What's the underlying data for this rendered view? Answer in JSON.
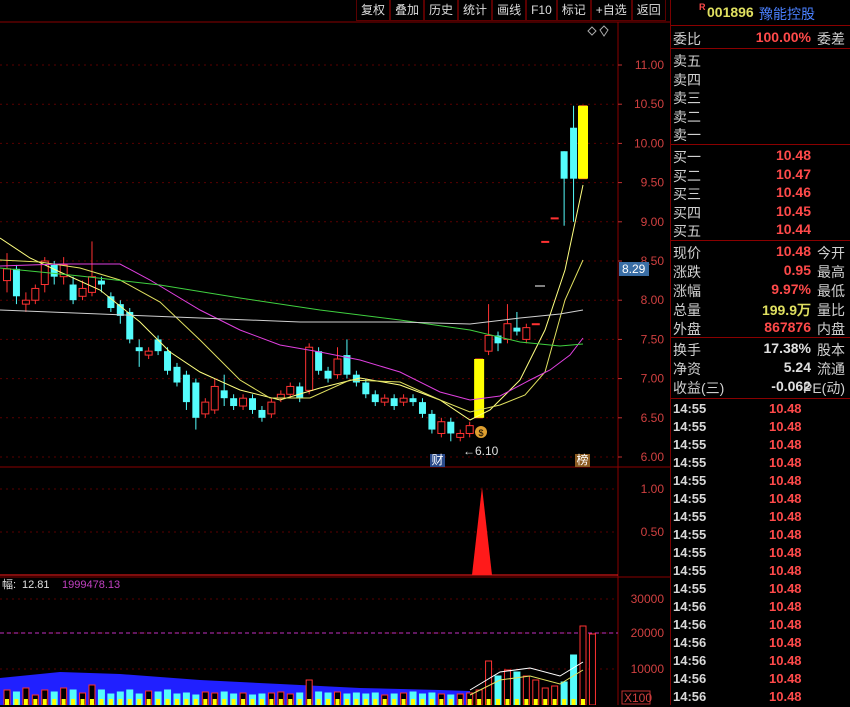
{
  "toolbar": [
    "复权",
    "叠加",
    "历史",
    "统计",
    "画线",
    "F10",
    "标记",
    "+自选",
    "返回"
  ],
  "price_axis": [
    "11.00",
    "10.50",
    "10.00",
    "9.50",
    "9.00",
    "8.50",
    "8.00",
    "7.50",
    "7.00",
    "6.50",
    "6.00"
  ],
  "indicator_axis": [
    "1.00",
    "0.50"
  ],
  "volume_axis": [
    "30000",
    "20000",
    "10000"
  ],
  "current_price_tag": "8.29",
  "low_label": "6.10",
  "markers": {
    "cai": "财",
    "bang": "榜"
  },
  "volume_legend": {
    "label": "幅:",
    "v1": "12.81",
    "v2": "1999478.13"
  },
  "volume_unit": "X100",
  "colors": {
    "up": "#ff3232",
    "down": "#54fcfc",
    "accent": "#ffff00"
  },
  "chart_data": {
    "type": "candlestick",
    "ylim": [
      6.0,
      11.0
    ],
    "candles": [
      {
        "o": 8.25,
        "c": 8.4,
        "h": 8.6,
        "l": 8.1
      },
      {
        "o": 8.4,
        "c": 8.05,
        "h": 8.45,
        "l": 7.95
      },
      {
        "o": 7.95,
        "c": 8.0,
        "h": 8.1,
        "l": 7.85
      },
      {
        "o": 8.0,
        "c": 8.15,
        "h": 8.2,
        "l": 7.95
      },
      {
        "o": 8.2,
        "c": 8.5,
        "h": 8.55,
        "l": 8.1
      },
      {
        "o": 8.45,
        "c": 8.3,
        "h": 8.5,
        "l": 8.2
      },
      {
        "o": 8.3,
        "c": 8.45,
        "h": 8.55,
        "l": 8.2
      },
      {
        "o": 8.2,
        "c": 8.0,
        "h": 8.3,
        "l": 7.95
      },
      {
        "o": 8.05,
        "c": 8.15,
        "h": 8.25,
        "l": 8.0
      },
      {
        "o": 8.1,
        "c": 8.3,
        "h": 8.75,
        "l": 8.05
      },
      {
        "o": 8.25,
        "c": 8.2,
        "h": 8.3,
        "l": 8.1
      },
      {
        "o": 8.05,
        "c": 7.9,
        "h": 8.1,
        "l": 7.85
      },
      {
        "o": 7.95,
        "c": 7.8,
        "h": 8.0,
        "l": 7.7
      },
      {
        "o": 7.85,
        "c": 7.5,
        "h": 7.9,
        "l": 7.45
      },
      {
        "o": 7.4,
        "c": 7.35,
        "h": 7.5,
        "l": 7.15
      },
      {
        "o": 7.3,
        "c": 7.35,
        "h": 7.4,
        "l": 7.25
      },
      {
        "o": 7.5,
        "c": 7.35,
        "h": 7.55,
        "l": 7.3
      },
      {
        "o": 7.35,
        "c": 7.1,
        "h": 7.4,
        "l": 7.05
      },
      {
        "o": 7.15,
        "c": 6.95,
        "h": 7.2,
        "l": 6.9
      },
      {
        "o": 7.05,
        "c": 6.7,
        "h": 7.1,
        "l": 6.6
      },
      {
        "o": 6.95,
        "c": 6.5,
        "h": 7.0,
        "l": 6.35
      },
      {
        "o": 6.55,
        "c": 6.7,
        "h": 6.75,
        "l": 6.5
      },
      {
        "o": 6.6,
        "c": 6.9,
        "h": 7.0,
        "l": 6.55
      },
      {
        "o": 6.85,
        "c": 6.75,
        "h": 7.05,
        "l": 6.65
      },
      {
        "o": 6.75,
        "c": 6.65,
        "h": 6.8,
        "l": 6.6
      },
      {
        "o": 6.65,
        "c": 6.75,
        "h": 6.8,
        "l": 6.6
      },
      {
        "o": 6.75,
        "c": 6.6,
        "h": 6.8,
        "l": 6.55
      },
      {
        "o": 6.6,
        "c": 6.5,
        "h": 6.65,
        "l": 6.45
      },
      {
        "o": 6.55,
        "c": 6.7,
        "h": 6.75,
        "l": 6.5
      },
      {
        "o": 6.75,
        "c": 6.8,
        "h": 6.85,
        "l": 6.7
      },
      {
        "o": 6.8,
        "c": 6.9,
        "h": 6.95,
        "l": 6.75
      },
      {
        "o": 6.9,
        "c": 6.75,
        "h": 6.95,
        "l": 6.7
      },
      {
        "o": 6.85,
        "c": 7.4,
        "h": 7.45,
        "l": 6.8
      },
      {
        "o": 7.35,
        "c": 7.1,
        "h": 7.4,
        "l": 7.05
      },
      {
        "o": 7.1,
        "c": 7.0,
        "h": 7.15,
        "l": 6.95
      },
      {
        "o": 7.05,
        "c": 7.25,
        "h": 7.4,
        "l": 7.0
      },
      {
        "o": 7.3,
        "c": 7.05,
        "h": 7.5,
        "l": 7.0
      },
      {
        "o": 7.05,
        "c": 6.95,
        "h": 7.1,
        "l": 6.9
      },
      {
        "o": 6.95,
        "c": 6.8,
        "h": 7.0,
        "l": 6.75
      },
      {
        "o": 6.8,
        "c": 6.7,
        "h": 6.85,
        "l": 6.65
      },
      {
        "o": 6.7,
        "c": 6.75,
        "h": 6.8,
        "l": 6.65
      },
      {
        "o": 6.75,
        "c": 6.65,
        "h": 6.8,
        "l": 6.6
      },
      {
        "o": 6.7,
        "c": 6.75,
        "h": 6.8,
        "l": 6.65
      },
      {
        "o": 6.75,
        "c": 6.7,
        "h": 6.8,
        "l": 6.65
      },
      {
        "o": 6.7,
        "c": 6.55,
        "h": 6.75,
        "l": 6.5
      },
      {
        "o": 6.55,
        "c": 6.35,
        "h": 6.6,
        "l": 6.3
      },
      {
        "o": 6.3,
        "c": 6.45,
        "h": 6.5,
        "l": 6.25
      },
      {
        "o": 6.45,
        "c": 6.3,
        "h": 6.5,
        "l": 6.2
      },
      {
        "o": 6.25,
        "c": 6.3,
        "h": 6.35,
        "l": 6.2
      },
      {
        "o": 6.3,
        "c": 6.4,
        "h": 6.45,
        "l": 6.25
      },
      {
        "o": 6.5,
        "c": 7.25,
        "h": 7.25,
        "l": 6.5
      },
      {
        "o": 7.35,
        "c": 7.55,
        "h": 7.95,
        "l": 7.3
      },
      {
        "o": 7.55,
        "c": 7.45,
        "h": 7.6,
        "l": 7.35
      },
      {
        "o": 7.5,
        "c": 7.7,
        "h": 7.95,
        "l": 7.45
      },
      {
        "o": 7.65,
        "c": 7.6,
        "h": 7.85,
        "l": 7.55
      },
      {
        "o": 7.5,
        "c": 7.65,
        "h": 7.7,
        "l": 7.45
      },
      {
        "o": 7.7,
        "c": 7.7,
        "h": 7.7,
        "l": 7.7
      },
      {
        "o": 8.75,
        "c": 8.75,
        "h": 8.75,
        "l": 8.75
      },
      {
        "o": 9.05,
        "c": 9.05,
        "h": 9.05,
        "l": 9.05
      },
      {
        "o": 9.9,
        "c": 9.55,
        "h": 9.9,
        "l": 8.95
      },
      {
        "o": 10.2,
        "c": 9.55,
        "h": 10.48,
        "l": 9.0
      },
      {
        "o": 9.55,
        "c": 10.48,
        "h": 10.48,
        "l": 9.55
      }
    ]
  },
  "stock": {
    "flag": "R",
    "code": "001896",
    "name": "豫能控股"
  },
  "weibi": {
    "label": "委比",
    "value": "100.00%",
    "label2": "委差"
  },
  "sell": [
    {
      "label": "卖五",
      "price": ""
    },
    {
      "label": "卖四",
      "price": ""
    },
    {
      "label": "卖三",
      "price": ""
    },
    {
      "label": "卖二",
      "price": ""
    },
    {
      "label": "卖一",
      "price": ""
    }
  ],
  "buy": [
    {
      "label": "买一",
      "price": "10.48"
    },
    {
      "label": "买二",
      "price": "10.47"
    },
    {
      "label": "买三",
      "price": "10.46"
    },
    {
      "label": "买四",
      "price": "10.45"
    },
    {
      "label": "买五",
      "price": "10.44"
    }
  ],
  "stats": [
    {
      "a": "现价",
      "b": "10.48",
      "c": "今开",
      "cls": "red"
    },
    {
      "a": "涨跌",
      "b": "0.95",
      "c": "最高",
      "cls": "red"
    },
    {
      "a": "涨幅",
      "b": "9.97%",
      "c": "最低",
      "cls": "red"
    },
    {
      "a": "总量",
      "b": "199.9万",
      "c": "量比",
      "cls": "yellow"
    },
    {
      "a": "外盘",
      "b": "867876",
      "c": "内盘",
      "cls": "red"
    }
  ],
  "stats2": [
    {
      "a": "换手",
      "b": "17.38%",
      "c": "股本",
      "cls": "white"
    },
    {
      "a": "净资",
      "b": "5.24",
      "c": "流通",
      "cls": "white"
    },
    {
      "a": "收益(三)",
      "b": "-0.062",
      "c": "PE(动)",
      "cls": "white"
    }
  ],
  "ticks": [
    {
      "t": "14:55",
      "p": "10.48"
    },
    {
      "t": "14:55",
      "p": "10.48"
    },
    {
      "t": "14:55",
      "p": "10.48"
    },
    {
      "t": "14:55",
      "p": "10.48"
    },
    {
      "t": "14:55",
      "p": "10.48"
    },
    {
      "t": "14:55",
      "p": "10.48"
    },
    {
      "t": "14:55",
      "p": "10.48"
    },
    {
      "t": "14:55",
      "p": "10.48"
    },
    {
      "t": "14:55",
      "p": "10.48"
    },
    {
      "t": "14:55",
      "p": "10.48"
    },
    {
      "t": "14:55",
      "p": "10.48"
    },
    {
      "t": "14:56",
      "p": "10.48"
    },
    {
      "t": "14:56",
      "p": "10.48"
    },
    {
      "t": "14:56",
      "p": "10.48"
    },
    {
      "t": "14:56",
      "p": "10.48"
    },
    {
      "t": "14:56",
      "p": "10.48"
    },
    {
      "t": "14:56",
      "p": "10.48"
    }
  ]
}
